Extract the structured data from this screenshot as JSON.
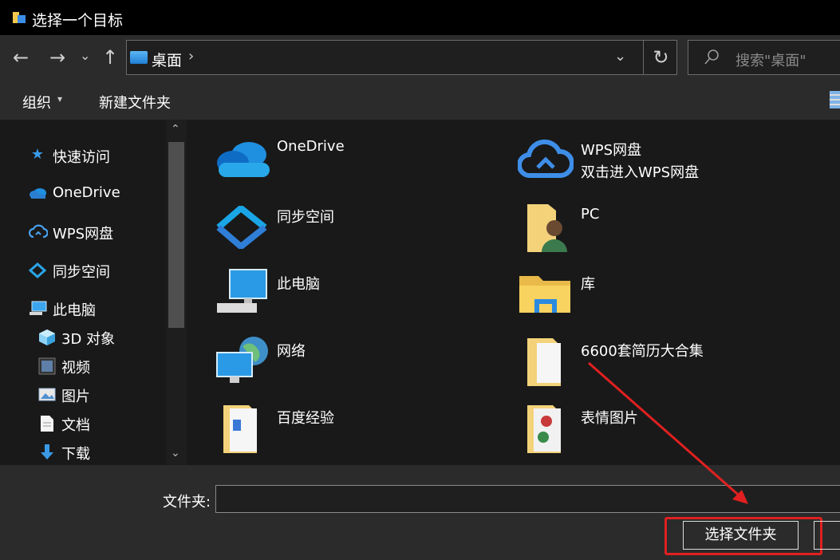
{
  "window": {
    "title": "选择一个目标"
  },
  "address": {
    "location": "桌面",
    "search_placeholder": "搜索\"桌面\""
  },
  "toolbar": {
    "organize_label": "组织",
    "new_folder_label": "新建文件夹"
  },
  "nav_pane": {
    "items": [
      {
        "label": "快速访问",
        "icon": "star-icon"
      },
      {
        "label": "OneDrive",
        "icon": "cloud-icon"
      },
      {
        "label": "WPS网盘",
        "icon": "wps-cloud-icon"
      },
      {
        "label": "同步空间",
        "icon": "sync-space-icon"
      },
      {
        "label": "此电脑",
        "icon": "computer-icon"
      },
      {
        "label": "3D 对象",
        "icon": "cube-icon"
      },
      {
        "label": "视频",
        "icon": "video-icon"
      },
      {
        "label": "图片",
        "icon": "picture-icon"
      },
      {
        "label": "文档",
        "icon": "document-icon"
      },
      {
        "label": "下载",
        "icon": "download-icon"
      }
    ]
  },
  "main_items": [
    {
      "name": "OneDrive",
      "icon": "onedrive-icon"
    },
    {
      "name": "WPS网盘",
      "subtitle": "双击进入WPS网盘",
      "icon": "wps-cloud-icon"
    },
    {
      "name": "同步空间",
      "icon": "sync-space-icon"
    },
    {
      "name": "PC",
      "icon": "user-folder-icon"
    },
    {
      "name": "此电脑",
      "icon": "computer-icon"
    },
    {
      "name": "库",
      "icon": "library-folder-icon"
    },
    {
      "name": "网络",
      "icon": "network-icon"
    },
    {
      "name": "6600套简历大合集",
      "icon": "folder-icon"
    },
    {
      "name": "百度经验",
      "icon": "folder-icon"
    },
    {
      "name": "表情图片",
      "icon": "folder-icon"
    }
  ],
  "footer": {
    "folder_label": "文件夹:",
    "folder_value": "",
    "select_button": "选择文件夹"
  },
  "colors": {
    "background": "#191919",
    "bar": "#2b2b2b",
    "accent_blue": "#1e7fd6",
    "highlight_red": "#e02020"
  }
}
